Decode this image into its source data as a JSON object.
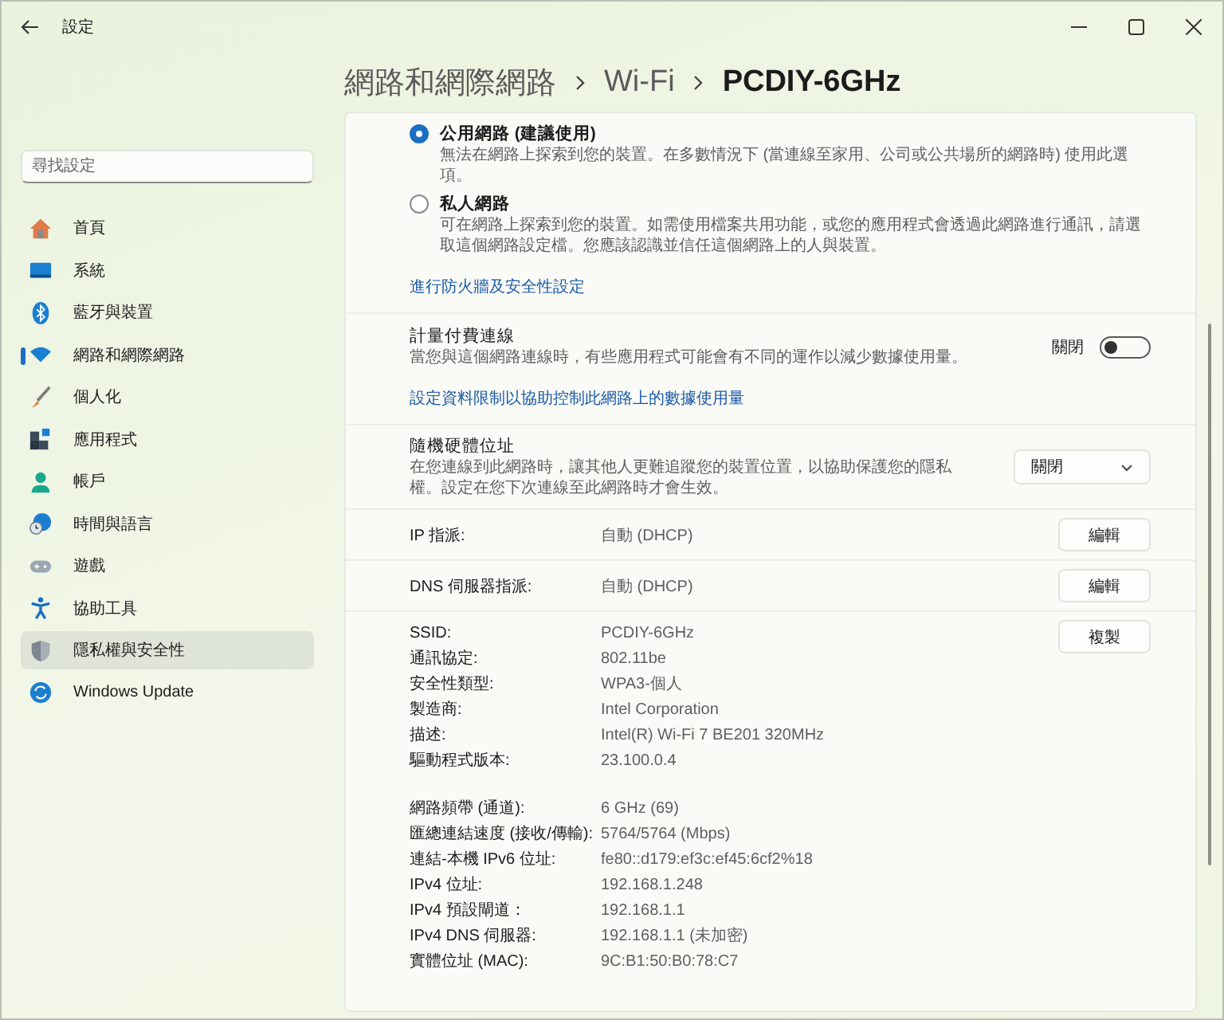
{
  "window": {
    "title": "設定"
  },
  "breadcrumb": [
    "網路和網際網路",
    "Wi-Fi",
    "PCDIY-6GHz"
  ],
  "search": {
    "placeholder": "尋找設定"
  },
  "sidebar": {
    "items": [
      {
        "label": "首頁",
        "selected": false,
        "hovered": false
      },
      {
        "label": "系統",
        "selected": false,
        "hovered": false
      },
      {
        "label": "藍牙與裝置",
        "selected": false,
        "hovered": false
      },
      {
        "label": "網路和網際網路",
        "selected": true,
        "hovered": false
      },
      {
        "label": "個人化",
        "selected": false,
        "hovered": false
      },
      {
        "label": "應用程式",
        "selected": false,
        "hovered": false
      },
      {
        "label": "帳戶",
        "selected": false,
        "hovered": false
      },
      {
        "label": "時間與語言",
        "selected": false,
        "hovered": false
      },
      {
        "label": "遊戲",
        "selected": false,
        "hovered": false
      },
      {
        "label": "協助工具",
        "selected": false,
        "hovered": false
      },
      {
        "label": "隱私權與安全性",
        "selected": false,
        "hovered": true
      },
      {
        "label": "Windows Update",
        "selected": false,
        "hovered": false
      }
    ]
  },
  "network_profile": {
    "options": [
      {
        "label": "公用網路 (建議使用)",
        "description": "無法在網路上探索到您的裝置。在多數情況下 (當連線至家用、公司或公共場所的網路時) 使用此選項。",
        "selected": true
      },
      {
        "label": "私人網路",
        "description": "可在網路上探索到您的裝置。如需使用檔案共用功能，或您的應用程式會透過此網路進行通訊，請選取這個網路設定檔。您應該認識並信任這個網路上的人與裝置。",
        "selected": false
      }
    ],
    "link": "進行防火牆及安全性設定"
  },
  "metered": {
    "title": "計量付費連線",
    "description": "當您與這個網路連線時，有些應用程式可能會有不同的運作以減少數據使用量。",
    "toggle": {
      "label": "關閉",
      "on": false
    },
    "link": "設定資料限制以協助控制此網路上的數據使用量"
  },
  "random_hardware_address": {
    "title": "隨機硬體位址",
    "description": "在您連線到此網路時，讓其他人更難追蹤您的裝置位置，以協助保護您的隱私權。設定在您下次連線至此網路時才會生效。",
    "dropdown": {
      "value": "關閉"
    }
  },
  "assignments": [
    {
      "label": "IP 指派:",
      "value": "自動 (DHCP)",
      "button": "編輯"
    },
    {
      "label": "DNS 伺服器指派:",
      "value": "自動 (DHCP)",
      "button": "編輯"
    }
  ],
  "properties": {
    "button": "複製",
    "groups": [
      [
        {
          "label": "SSID:",
          "value": "PCDIY-6GHz"
        },
        {
          "label": "通訊協定:",
          "value": "802.11be"
        },
        {
          "label": "安全性類型:",
          "value": "WPA3-個人"
        },
        {
          "label": "製造商:",
          "value": "Intel Corporation"
        },
        {
          "label": "描述:",
          "value": "Intel(R) Wi-Fi 7 BE201 320MHz"
        },
        {
          "label": "驅動程式版本:",
          "value": "23.100.0.4"
        }
      ],
      [
        {
          "label": "網路頻帶 (通道):",
          "value": "6 GHz (69)"
        },
        {
          "label": "匯總連結速度 (接收/傳輸):",
          "value": "5764/5764 (Mbps)"
        },
        {
          "label": "連結-本機 IPv6 位址:",
          "value": "fe80::d179:ef3c:ef45:6cf2%18"
        },
        {
          "label": "IPv4 位址:",
          "value": "192.168.1.248"
        },
        {
          "label": "IPv4 預設閘道：",
          "value": "192.168.1.1"
        },
        {
          "label": "IPv4 DNS 伺服器:",
          "value": "192.168.1.1 (未加密)"
        },
        {
          "label": "實體位址 (MAC):",
          "value": "9C:B1:50:B0:78:C7"
        }
      ]
    ]
  }
}
